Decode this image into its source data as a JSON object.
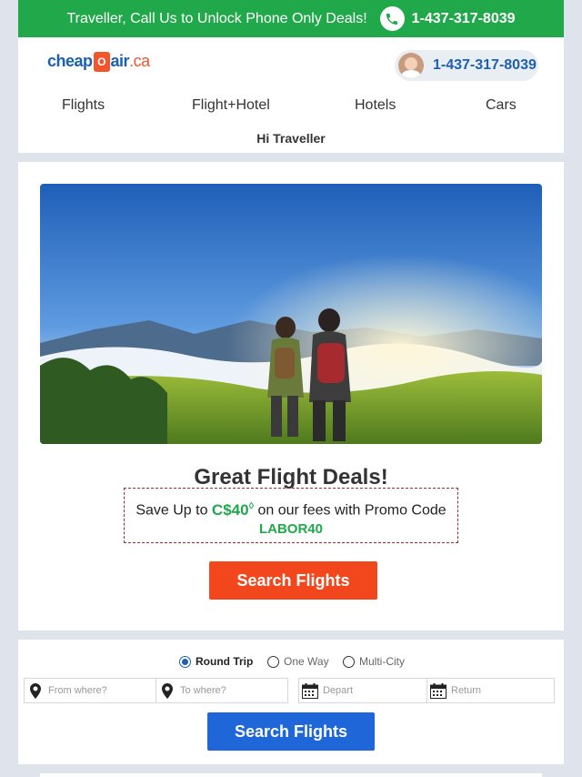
{
  "topbar": {
    "message": "Traveller, Call Us to Unlock Phone Only Deals!",
    "phone": "1-437-317-8039",
    "icon": "phone-icon",
    "bg_color": "#21a84a"
  },
  "header": {
    "logo": {
      "word": "cheap",
      "o": "O",
      "air": "air",
      "tld": ".ca"
    },
    "agent_phone": "1-437-317-8039",
    "nav": [
      "Flights",
      "Flight+Hotel",
      "Hotels",
      "Cars"
    ],
    "greeting": "Hi Traveller"
  },
  "hero": {
    "title": "Great Flight Deals!",
    "promo": {
      "prefix": "Save Up to",
      "amount": "C$40",
      "amount_mark": "◊",
      "suffix": "on our fees with Promo Code",
      "code": "LABOR40"
    },
    "cta": "Search Flights",
    "cta_color": "#f2471c"
  },
  "search": {
    "trip_types": [
      {
        "label": "Round Trip",
        "selected": true
      },
      {
        "label": "One Way",
        "selected": false
      },
      {
        "label": "Multi-City",
        "selected": false
      }
    ],
    "from_placeholder": "From where?",
    "to_placeholder": "To where?",
    "depart_placeholder": "Depart",
    "return_placeholder": "Return",
    "cta": "Search Flights",
    "cta_color": "#1f67d8"
  }
}
